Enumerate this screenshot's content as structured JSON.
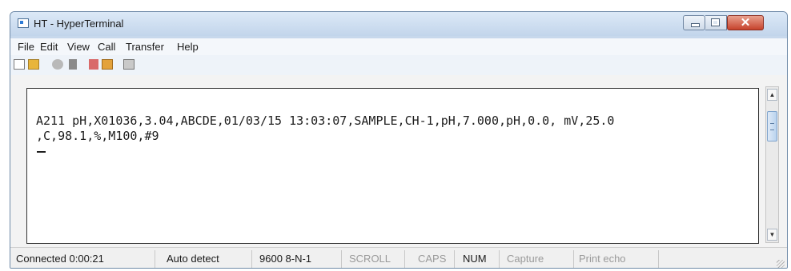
{
  "window": {
    "title": "HT - HyperTerminal"
  },
  "menu": [
    "File",
    "Edit",
    "View",
    "Call",
    "Transfer",
    "Help"
  ],
  "toolbar": [
    "new-icon",
    "open-icon",
    "disconnect-icon",
    "dial-icon",
    "send-icon",
    "receive-icon",
    "properties-icon"
  ],
  "terminal": {
    "line1": "A211 pH,X01036,3.04,ABCDE,01/03/15 13:03:07,SAMPLE,CH-1,pH,7.000,pH,0.0, mV,25.0",
    "line2": ",C,98.1,%,M100,#9",
    "line3": "_"
  },
  "status": {
    "connected": "Connected 0:00:21",
    "detect": "Auto detect",
    "settings": "9600 8-N-1",
    "scroll": "SCROLL",
    "caps": "CAPS",
    "num": "NUM",
    "capture": "Capture",
    "echo": "Print echo"
  }
}
